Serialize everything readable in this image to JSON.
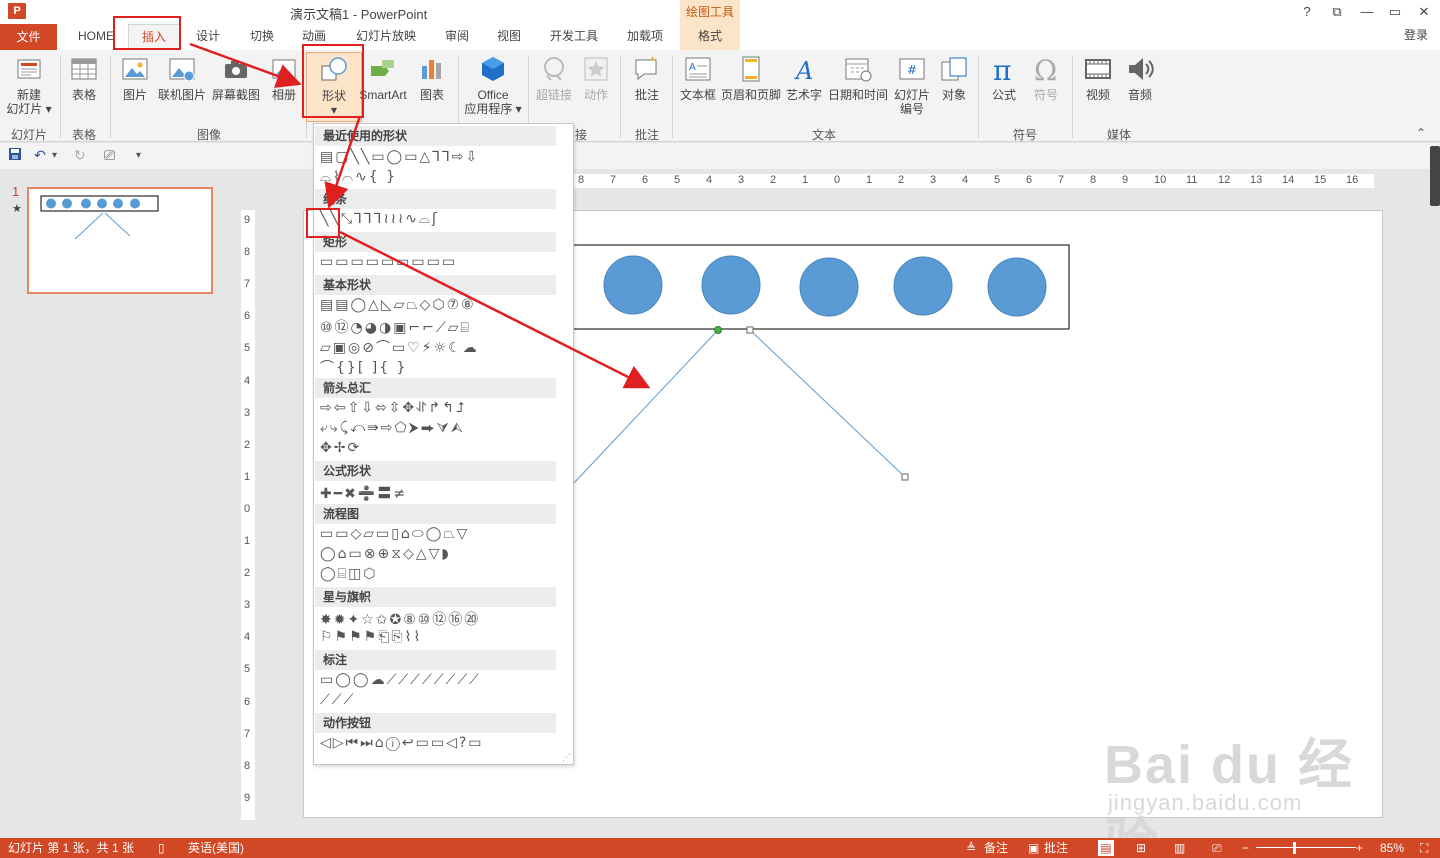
{
  "titlebar": {
    "app_icon": "P",
    "title": "演示文稿1 - PowerPoint",
    "contextual_label": "绘图工具",
    "help": "?",
    "restore_ribbon": "⧉",
    "minimize": "—",
    "maximize": "▭",
    "close": "✕"
  },
  "tabs": {
    "file": "文件",
    "home": "HOME",
    "insert": "插入",
    "design": "设计",
    "transitions": "切换",
    "animations": "动画",
    "slideshow": "幻灯片放映",
    "review": "审阅",
    "view": "视图",
    "developer": "开发工具",
    "addins": "加载项",
    "format": "格式",
    "login": "登录"
  },
  "ribbon": {
    "new_slide": "新建",
    "new_slide2": "幻灯片 ▾",
    "table": "表格",
    "picture": "图片",
    "online_picture": "联机图片",
    "screenshot": "屏幕截图",
    "album": "相册",
    "shapes": "形状",
    "smartart": "SmartArt",
    "chart": "图表",
    "office_apps": "Office",
    "office_apps2": "应用程序 ▾",
    "hyperlink": "超链接",
    "action": "动作",
    "comment": "批注",
    "textbox": "文本框",
    "header_footer": "页眉和页脚",
    "wordart": "艺术字",
    "datetime": "日期和时间",
    "slide_number": "幻灯片",
    "slide_number2": "编号",
    "object": "对象",
    "equation": "公式",
    "symbol": "符号",
    "video": "视频",
    "audio": "音频",
    "groups": {
      "slides": "幻灯片",
      "tables": "表格",
      "images": "图像",
      "links": "接",
      "comments": "批注",
      "text": "文本",
      "symbols": "符号",
      "media": "媒体"
    }
  },
  "shapes_menu": {
    "recent": "最近使用的形状",
    "lines": "线条",
    "rectangles": "矩形",
    "basic": "基本形状",
    "arrows": "箭头总汇",
    "equation": "公式形状",
    "flowchart": "流程图",
    "stars": "星与旗帜",
    "callouts": "标注",
    "action_buttons": "动作按钮",
    "rows": {
      "recent1": "▤▢╲╲▭◯▭△⅂⅂⇨⇩",
      "recent2": "⌓⌇⌒∿{ }",
      "lines1": "╲╲⤡⅂⅂⅂≀≀≀∿⌓ʃ",
      "rect1": "▭▭▭▭▭▭▭▭▭",
      "basic1": "▤▤◯△◺▱⏢◇⬡⑦⑧",
      "basic2": "⑩⑫◔◕◑▣⌐⌐⟋▱⌸",
      "basic3": "▱▣◎⊘⌒▭♡⚡☼☾☁",
      "basic4": "⌒{}[ ]{ }",
      "arrows1": "⇨⇦⇧⇩⬄⇳✥⥯↱↰⮥",
      "arrows2": "⤶⤷⤹⤺⇛⇨⬠⮞⮕⮛⮙",
      "arrows3": "✥✢⟳",
      "eq1": "✚━✖➗〓≠",
      "flow1": "▭▭◇▱▭▯⌂⬭◯⏢▽",
      "flow2": "◯⌂▭⊗⊕⧖◇△▽◗",
      "flow3": "◯⌸◫⬡",
      "stars1": "✸✹✦☆✩✪⑧⑩⑫⑯⑳",
      "stars2": "⚐⚑⚑⚑⎗⎘⌇⌇",
      "callouts1": "▭◯◯☁⟋⟋⟋⟋⟋⟋⟋⟋",
      "callouts2": "⟋⟋⟋",
      "actions1": "◁▷⏮⏭⌂ⓘ↩▭▭◁?▭"
    }
  },
  "qat": {
    "save": "💾",
    "undo": "↶",
    "redo": "↻",
    "present": "⎚",
    "customize": "▾"
  },
  "slide_pane": {
    "num": "1",
    "star": "★"
  },
  "hruler_labels": [
    "8",
    "7",
    "6",
    "5",
    "4",
    "3",
    "2",
    "1",
    "0",
    "1",
    "2",
    "3",
    "4",
    "5",
    "6",
    "7",
    "8",
    "9",
    "10",
    "11",
    "12",
    "13",
    "14",
    "15",
    "16"
  ],
  "vruler_labels": [
    "9",
    "8",
    "7",
    "6",
    "5",
    "4",
    "3",
    "2",
    "1",
    "0",
    "1",
    "2",
    "3",
    "4",
    "5",
    "6",
    "7",
    "8",
    "9"
  ],
  "status": {
    "slide_info": "幻灯片 第 1 张，共 1 张",
    "language": "英语(美国)",
    "notes": "备注",
    "comments": "批注",
    "zoom": "85%"
  },
  "watermark": {
    "brand": "Bai du 经验",
    "url": "jingyan.baidu.com"
  },
  "colors": {
    "accent": "#d24726",
    "circle_fill": "#5b9bd5",
    "line": "#5b9bd5",
    "annotation": "#e02020"
  }
}
